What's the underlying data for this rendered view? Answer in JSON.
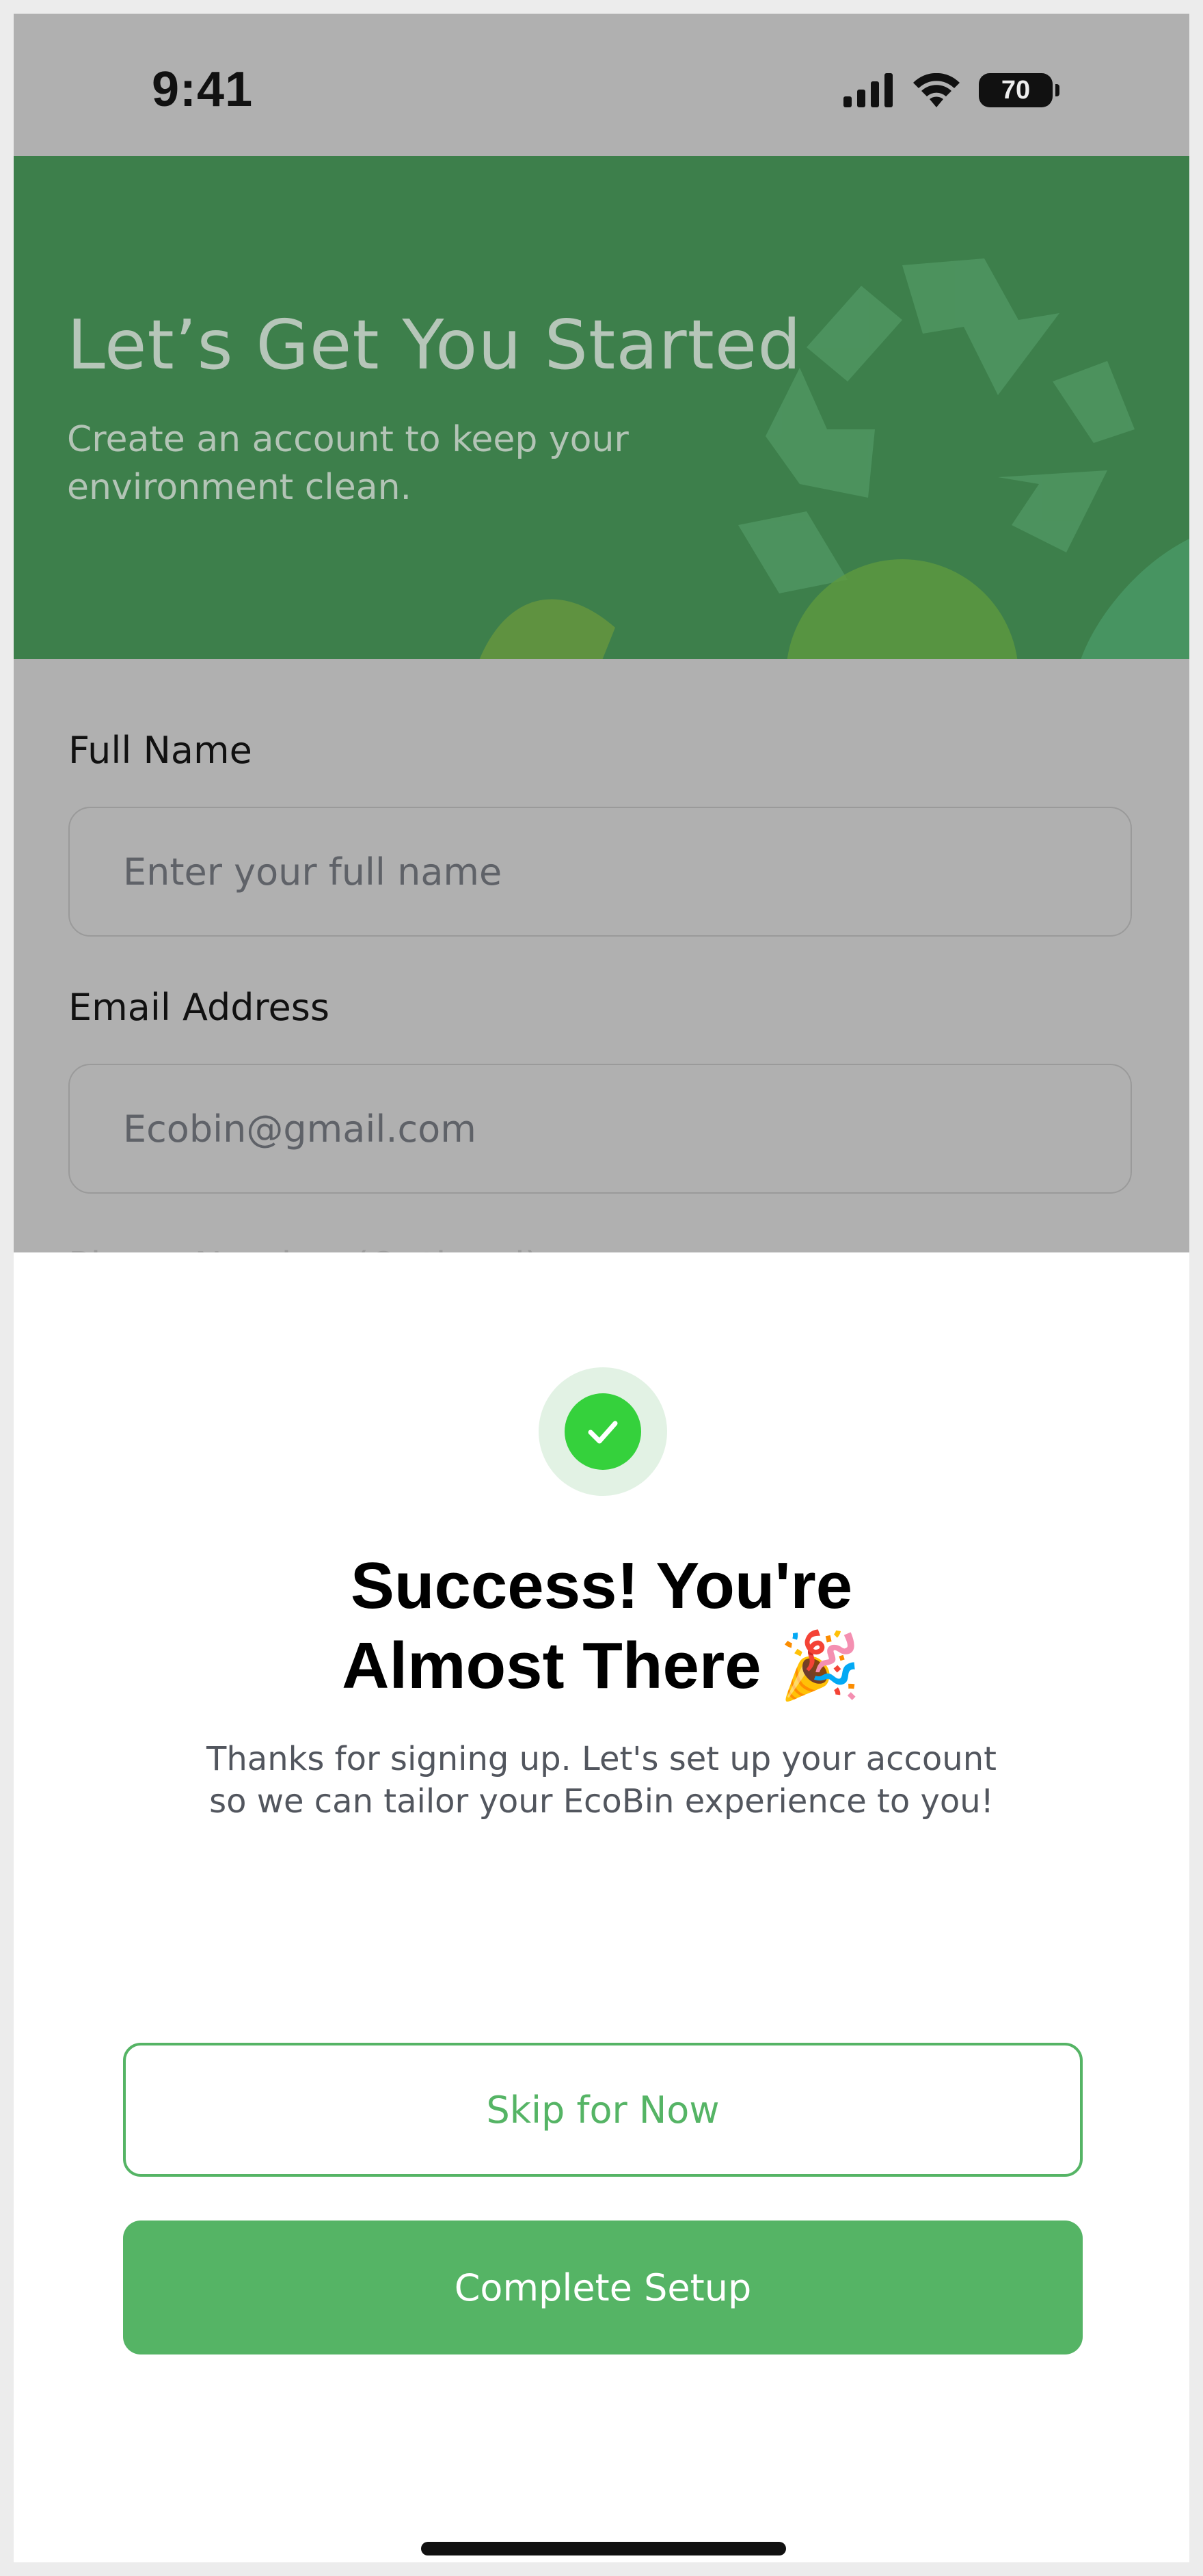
{
  "status_bar": {
    "time": "9:41",
    "battery": "70"
  },
  "hero": {
    "title": "Let’s Get You Started",
    "subtitle": "Create an account to keep your environment clean."
  },
  "form": {
    "full_name": {
      "label": "Full Name",
      "placeholder": "Enter your full name"
    },
    "email": {
      "label": "Email Address",
      "placeholder": "Ecobin@gmail.com"
    },
    "phone_label_partial": "Phone Number (Optional)"
  },
  "modal": {
    "title_line1": "Success! You're",
    "title_line2": "Almost There",
    "emoji": "🎉",
    "message": "Thanks for signing up. Let's set up your account so we can tailor your EcoBin experience to you!",
    "skip_label": "Skip for Now",
    "complete_label": "Complete Setup"
  },
  "colors": {
    "accent_green": "#55b465",
    "hero_green": "#3d7f4b",
    "success_check": "#35d13c",
    "overlay_gray": "#b0b0b0"
  },
  "icons": [
    "signal-icon",
    "wifi-icon",
    "battery-icon",
    "recycle-icon",
    "check-icon"
  ]
}
